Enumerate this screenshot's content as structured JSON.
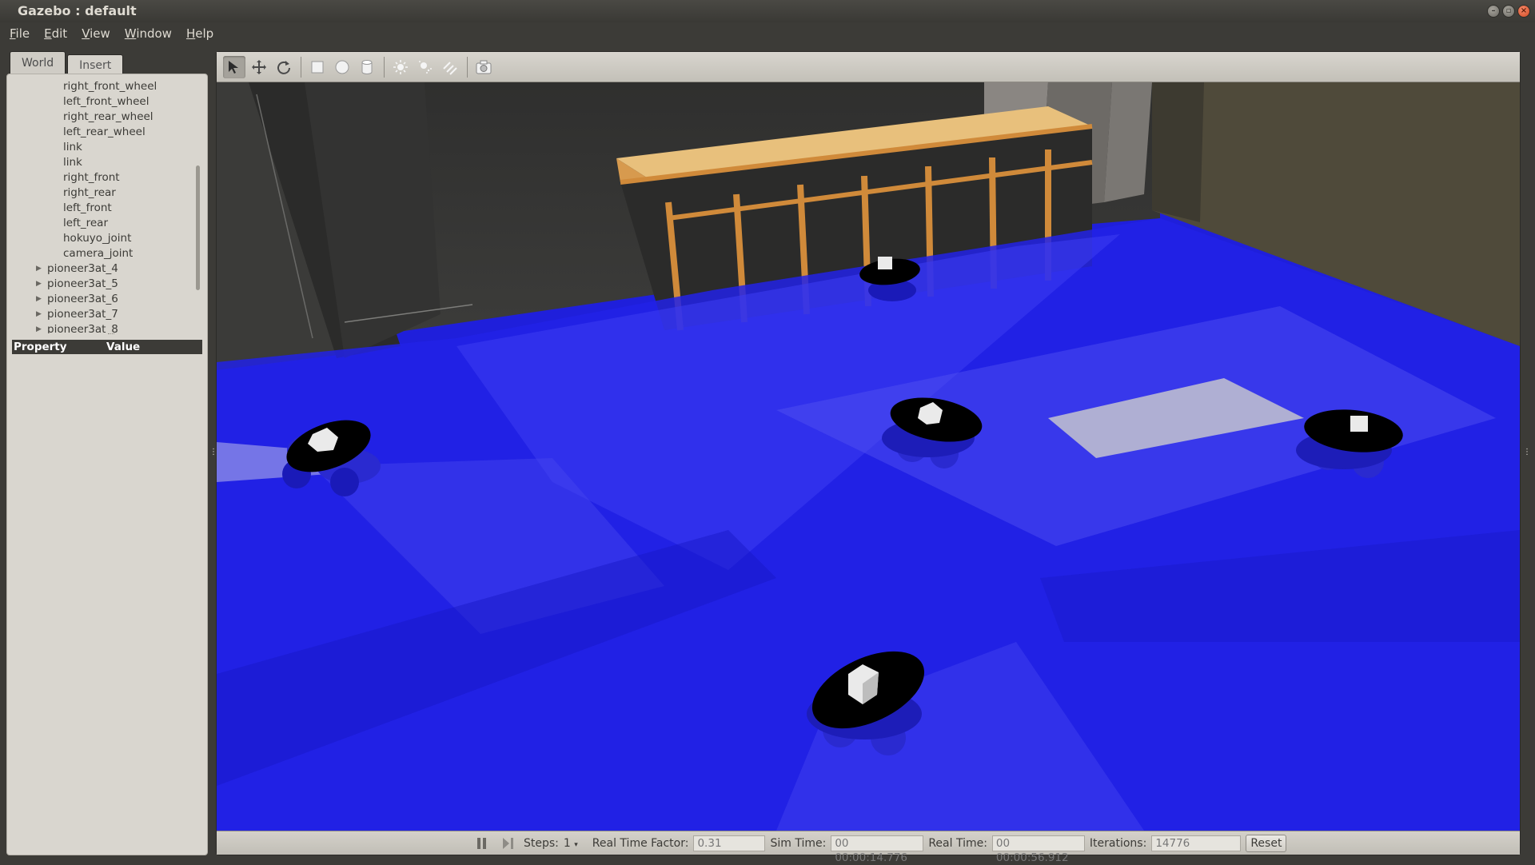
{
  "window": {
    "title": "Gazebo : default",
    "controls": [
      "minimize",
      "maximize",
      "close"
    ]
  },
  "menubar": {
    "items": [
      {
        "mnemonic": "F",
        "rest": "ile"
      },
      {
        "mnemonic": "E",
        "rest": "dit"
      },
      {
        "mnemonic": "V",
        "rest": "iew"
      },
      {
        "mnemonic": "W",
        "rest": "indow"
      },
      {
        "mnemonic": "H",
        "rest": "elp"
      }
    ]
  },
  "left_panel": {
    "tabs": [
      "World",
      "Insert"
    ],
    "active_tab": "World",
    "tree": {
      "children": [
        "right_front_wheel",
        "left_front_wheel",
        "right_rear_wheel",
        "left_rear_wheel",
        "link",
        "link",
        "right_front",
        "right_rear",
        "left_front",
        "left_rear",
        "hokuyo_joint",
        "camera_joint"
      ],
      "models": [
        "pioneer3at_4",
        "pioneer3at_5",
        "pioneer3at_6",
        "pioneer3at_7",
        "pioneer3at_8"
      ]
    },
    "property_table": {
      "col_property": "Property",
      "col_value": "Value"
    }
  },
  "toolbar": {
    "tools": [
      "select-mode",
      "translate-mode",
      "rotate-mode",
      "box-shape",
      "sphere-shape",
      "cylinder-shape",
      "point-light",
      "spot-light",
      "directional-light",
      "screenshot"
    ],
    "active_tool": "select-mode"
  },
  "scene": {
    "floor_color": "#1f1fdb",
    "wall_color": "#3a3a38",
    "counter_color": "#e6b86e"
  },
  "statusbar": {
    "steps_label": "Steps:",
    "steps_value": "1",
    "rtf_label": "Real Time Factor:",
    "rtf_value": "0.31",
    "sim_time_label": "Sim Time:",
    "sim_time_value": "00 00:00:14.776",
    "real_time_label": "Real Time:",
    "real_time_value": "00 00:00:56.912",
    "iterations_label": "Iterations:",
    "iterations_value": "14776",
    "reset_label": "Reset"
  }
}
